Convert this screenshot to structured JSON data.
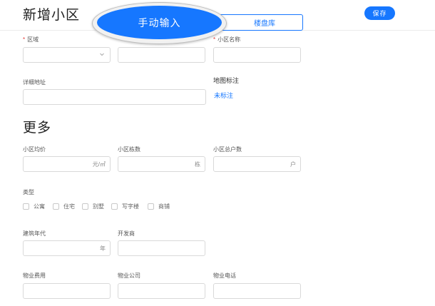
{
  "header": {
    "title": "新增小区",
    "tabs": {
      "manual": "手动输入",
      "library": "楼盘库"
    },
    "save_label": "保存"
  },
  "basic": {
    "district_label": "区域",
    "community_name_label": "小区名称",
    "address_label": "详细地址",
    "map_label": "地图标注",
    "map_status": "未标注"
  },
  "more": {
    "title": "更多",
    "avg_price_label": "小区均价",
    "avg_price_unit": "元/㎡",
    "building_count_label": "小区栋数",
    "building_count_unit": "栋",
    "household_label": "小区总户数",
    "household_unit": "户",
    "type_label": "类型",
    "types": [
      "公寓",
      "住宅",
      "别墅",
      "写字楼",
      "商铺"
    ],
    "build_year_label": "建筑年代",
    "build_year_unit": "年",
    "developer_label": "开发商",
    "property_fee_label": "物业费用",
    "property_company_label": "物业公司",
    "property_phone_label": "物业电话"
  },
  "colors": {
    "accent": "#1677ff",
    "required": "#e53935"
  }
}
